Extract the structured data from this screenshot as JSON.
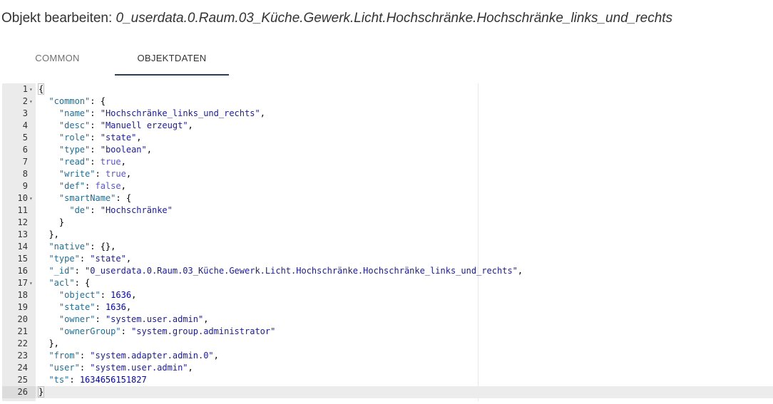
{
  "title": {
    "prefix": "Objekt bearbeiten: ",
    "object_id": "0_userdata.0.Raum.03_Küche.Gewerk.Licht.Hochschränke.Hochschränke_links_und_rechts"
  },
  "tabs": [
    {
      "label": "COMMON",
      "active": false
    },
    {
      "label": "OBJEKTDATEN",
      "active": true
    }
  ],
  "colors": {
    "accent": "#2d3e50",
    "key": "#1c6e9c",
    "string": "#1a1aa6",
    "number": "#0000cd",
    "boolean": "#5853e2",
    "gutter": "#ebebeb"
  },
  "editor": {
    "active_line": 26,
    "lines": [
      {
        "n": "1",
        "fold": true,
        "indent": 0,
        "tokens": [
          [
            "p",
            "{"
          ]
        ]
      },
      {
        "n": "2",
        "fold": true,
        "indent": 1,
        "tokens": [
          [
            "k",
            "\"common\""
          ],
          [
            "p",
            ": {"
          ]
        ]
      },
      {
        "n": "3",
        "fold": false,
        "indent": 2,
        "tokens": [
          [
            "k",
            "\"name\""
          ],
          [
            "p",
            ": "
          ],
          [
            "s",
            "\"Hochschränke_links_und_rechts\""
          ],
          [
            "p",
            ","
          ]
        ]
      },
      {
        "n": "4",
        "fold": false,
        "indent": 2,
        "tokens": [
          [
            "k",
            "\"desc\""
          ],
          [
            "p",
            ": "
          ],
          [
            "s",
            "\"Manuell erzeugt\""
          ],
          [
            "p",
            ","
          ]
        ]
      },
      {
        "n": "5",
        "fold": false,
        "indent": 2,
        "tokens": [
          [
            "k",
            "\"role\""
          ],
          [
            "p",
            ": "
          ],
          [
            "s",
            "\"state\""
          ],
          [
            "p",
            ","
          ]
        ]
      },
      {
        "n": "6",
        "fold": false,
        "indent": 2,
        "tokens": [
          [
            "k",
            "\"type\""
          ],
          [
            "p",
            ": "
          ],
          [
            "s",
            "\"boolean\""
          ],
          [
            "p",
            ","
          ]
        ]
      },
      {
        "n": "7",
        "fold": false,
        "indent": 2,
        "tokens": [
          [
            "k",
            "\"read\""
          ],
          [
            "p",
            ": "
          ],
          [
            "b",
            "true"
          ],
          [
            "p",
            ","
          ]
        ]
      },
      {
        "n": "8",
        "fold": false,
        "indent": 2,
        "tokens": [
          [
            "k",
            "\"write\""
          ],
          [
            "p",
            ": "
          ],
          [
            "b",
            "true"
          ],
          [
            "p",
            ","
          ]
        ]
      },
      {
        "n": "9",
        "fold": false,
        "indent": 2,
        "tokens": [
          [
            "k",
            "\"def\""
          ],
          [
            "p",
            ": "
          ],
          [
            "b",
            "false"
          ],
          [
            "p",
            ","
          ]
        ]
      },
      {
        "n": "10",
        "fold": true,
        "indent": 2,
        "tokens": [
          [
            "k",
            "\"smartName\""
          ],
          [
            "p",
            ": {"
          ]
        ]
      },
      {
        "n": "11",
        "fold": false,
        "indent": 3,
        "tokens": [
          [
            "k",
            "\"de\""
          ],
          [
            "p",
            ": "
          ],
          [
            "s",
            "\"Hochschränke\""
          ]
        ]
      },
      {
        "n": "12",
        "fold": false,
        "indent": 2,
        "tokens": [
          [
            "p",
            "}"
          ]
        ]
      },
      {
        "n": "13",
        "fold": false,
        "indent": 1,
        "tokens": [
          [
            "p",
            "},"
          ]
        ]
      },
      {
        "n": "14",
        "fold": false,
        "indent": 1,
        "tokens": [
          [
            "k",
            "\"native\""
          ],
          [
            "p",
            ": {},"
          ]
        ]
      },
      {
        "n": "15",
        "fold": false,
        "indent": 1,
        "tokens": [
          [
            "k",
            "\"type\""
          ],
          [
            "p",
            ": "
          ],
          [
            "s",
            "\"state\""
          ],
          [
            "p",
            ","
          ]
        ]
      },
      {
        "n": "16",
        "fold": false,
        "indent": 1,
        "tokens": [
          [
            "k",
            "\"_id\""
          ],
          [
            "p",
            ": "
          ],
          [
            "s",
            "\"0_userdata.0.Raum.03_Küche.Gewerk.Licht.Hochschränke.Hochschränke_links_und_rechts\""
          ],
          [
            "p",
            ","
          ]
        ]
      },
      {
        "n": "17",
        "fold": true,
        "indent": 1,
        "tokens": [
          [
            "k",
            "\"acl\""
          ],
          [
            "p",
            ": {"
          ]
        ]
      },
      {
        "n": "18",
        "fold": false,
        "indent": 2,
        "tokens": [
          [
            "k",
            "\"object\""
          ],
          [
            "p",
            ": "
          ],
          [
            "n",
            "1636"
          ],
          [
            "p",
            ","
          ]
        ]
      },
      {
        "n": "19",
        "fold": false,
        "indent": 2,
        "tokens": [
          [
            "k",
            "\"state\""
          ],
          [
            "p",
            ": "
          ],
          [
            "n",
            "1636"
          ],
          [
            "p",
            ","
          ]
        ]
      },
      {
        "n": "20",
        "fold": false,
        "indent": 2,
        "tokens": [
          [
            "k",
            "\"owner\""
          ],
          [
            "p",
            ": "
          ],
          [
            "s",
            "\"system.user.admin\""
          ],
          [
            "p",
            ","
          ]
        ]
      },
      {
        "n": "21",
        "fold": false,
        "indent": 2,
        "tokens": [
          [
            "k",
            "\"ownerGroup\""
          ],
          [
            "p",
            ": "
          ],
          [
            "s",
            "\"system.group.administrator\""
          ]
        ]
      },
      {
        "n": "22",
        "fold": false,
        "indent": 1,
        "tokens": [
          [
            "p",
            "},"
          ]
        ]
      },
      {
        "n": "23",
        "fold": false,
        "indent": 1,
        "tokens": [
          [
            "k",
            "\"from\""
          ],
          [
            "p",
            ": "
          ],
          [
            "s",
            "\"system.adapter.admin.0\""
          ],
          [
            "p",
            ","
          ]
        ]
      },
      {
        "n": "24",
        "fold": false,
        "indent": 1,
        "tokens": [
          [
            "k",
            "\"user\""
          ],
          [
            "p",
            ": "
          ],
          [
            "s",
            "\"system.user.admin\""
          ],
          [
            "p",
            ","
          ]
        ]
      },
      {
        "n": "25",
        "fold": false,
        "indent": 1,
        "tokens": [
          [
            "k",
            "\"ts\""
          ],
          [
            "p",
            ": "
          ],
          [
            "n",
            "1634656151827"
          ]
        ]
      },
      {
        "n": "26",
        "fold": false,
        "indent": 0,
        "tokens": [
          [
            "p",
            "}"
          ]
        ]
      }
    ]
  }
}
